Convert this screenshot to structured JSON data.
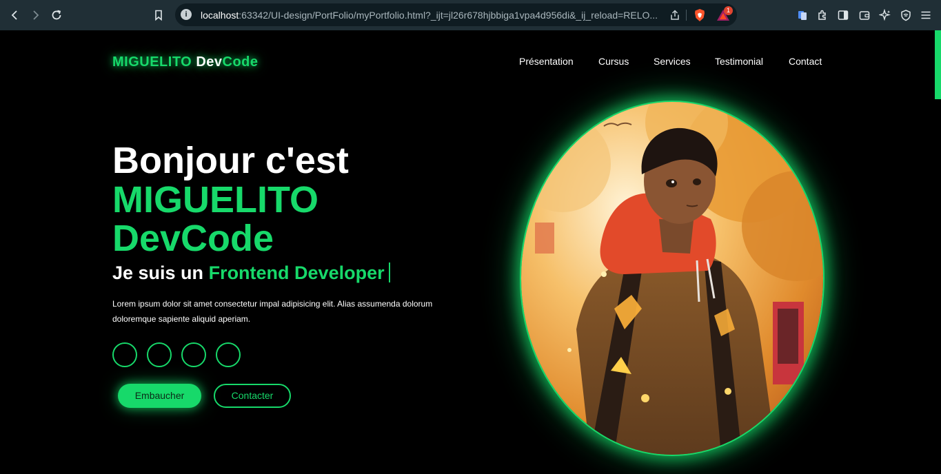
{
  "browser": {
    "url_host": "localhost",
    "url_rest": ":63342/UI-design/PortFolio/myPortfolio.html?_ijt=jl26r678hjbbiga1vpa4d956di&_ij_reload=RELO...",
    "notification_count": "1"
  },
  "logo": {
    "part1": "MIGUELITO",
    "part2": "Dev",
    "part3": "Code"
  },
  "nav": [
    "Présentation",
    "Cursus",
    "Services",
    "Testimonial",
    "Contact"
  ],
  "hero": {
    "line1": "Bonjour c'est",
    "line2": "MIGUELITO",
    "line3": "DevCode",
    "subtitle_prefix": "Je suis un",
    "subtitle_role": "Frontend Developer",
    "description": "Lorem ipsum dolor sit amet consectetur impal adipisicing elit. Alias assumenda dolorum doloremque sapiente aliquid aperiam."
  },
  "buttons": {
    "hire": "Embaucher",
    "contact": "Contacter"
  },
  "colors": {
    "accent": "#17d96a",
    "background": "#000000",
    "chrome": "#202f36"
  }
}
